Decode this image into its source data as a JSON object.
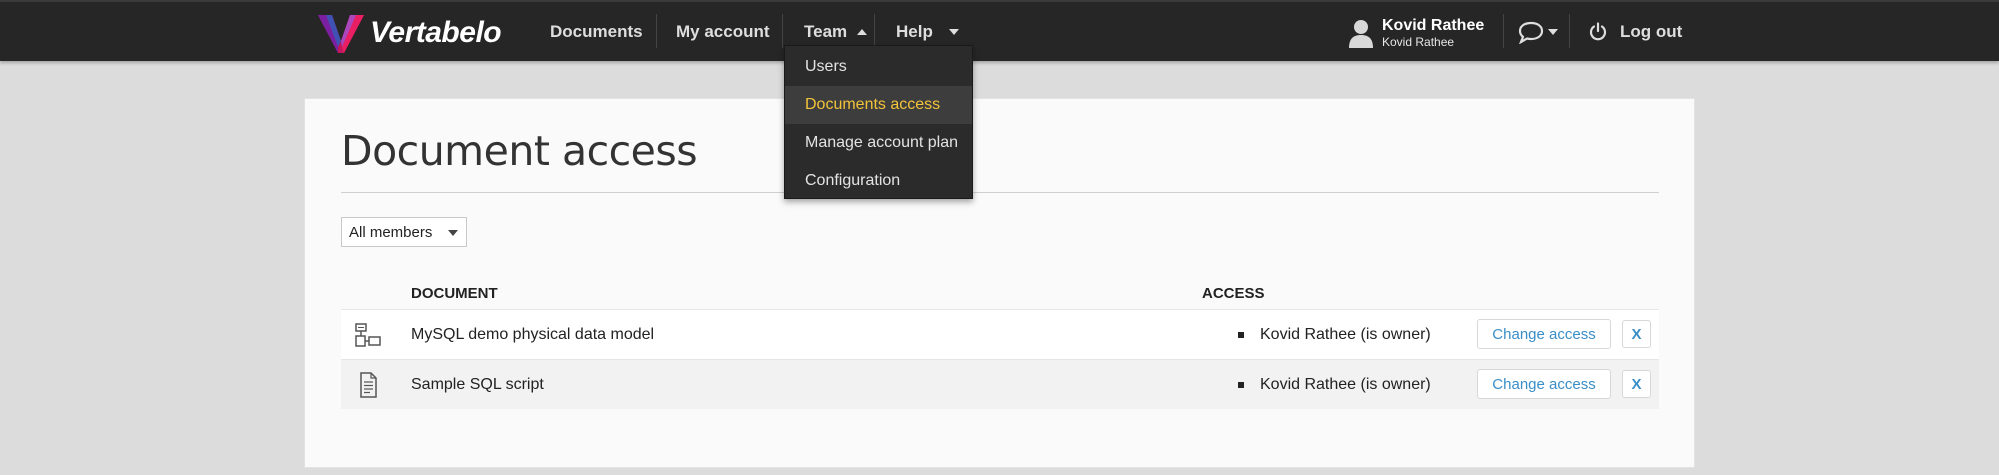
{
  "brand": {
    "name": "Vertabelo"
  },
  "nav": {
    "documents": "Documents",
    "my_account": "My account",
    "team": "Team",
    "help": "Help",
    "logout": "Log out",
    "user_name": "Kovid Rathee",
    "user_sub": "Kovid Rathee"
  },
  "team_menu": {
    "items": [
      "Users",
      "Documents access",
      "Manage account plan",
      "Configuration"
    ],
    "active": "Documents access"
  },
  "page": {
    "title": "Document access",
    "filter": {
      "selected": "All members"
    },
    "table": {
      "headers": {
        "document": "DOCUMENT",
        "access": "ACCESS"
      },
      "rows": [
        {
          "document": "MySQL demo physical data model",
          "access": "Kovid Rathee (is owner)",
          "action": "Change access",
          "remove": "X",
          "icon": "physical-model-icon"
        },
        {
          "document": "Sample SQL script",
          "access": "Kovid Rathee (is owner)",
          "action": "Change access",
          "remove": "X",
          "icon": "sql-script-icon"
        }
      ]
    }
  },
  "colors": {
    "topbar": "#262626",
    "active_menu_text": "#f3c33a",
    "link_blue": "#3a8ec7"
  }
}
